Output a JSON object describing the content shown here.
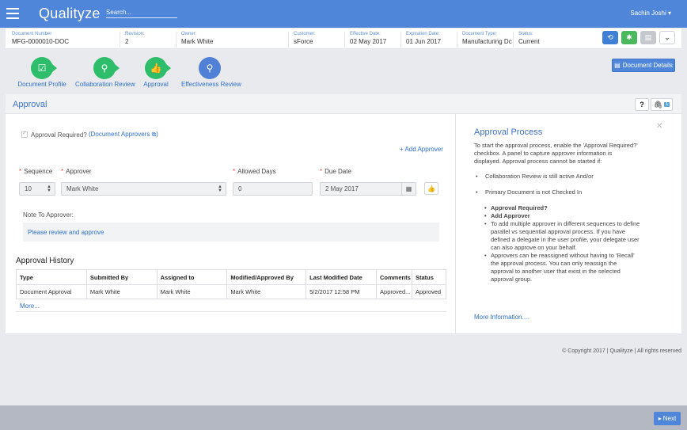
{
  "app": {
    "logo": "Qualityze",
    "search_placeholder": "Search...",
    "user": "Sachin Joshi ▾"
  },
  "info": [
    {
      "label": "Document Number",
      "value": "MFG-0000010-DOC"
    },
    {
      "label": "Revision:",
      "value": "2"
    },
    {
      "label": "Owner:",
      "value": "Mark White"
    },
    {
      "label": "Customer:",
      "value": "sForce"
    },
    {
      "label": "Effective Date:",
      "value": "02 May 2017"
    },
    {
      "label": "Expiration Date:",
      "value": "01 Jun 2017"
    },
    {
      "label": "Document Type:",
      "value": "Manufacturing Dc"
    },
    {
      "label": "Status:",
      "value": "Current"
    }
  ],
  "toolbar_colors": {
    "refresh": "#3f7fd6",
    "settings": "#4cb85c",
    "print": "#c5c8cd",
    "more": "#ffffff"
  },
  "steps": [
    {
      "label": "Document Profile"
    },
    {
      "label": "Collaboration Review"
    },
    {
      "label": "Approval"
    },
    {
      "label": "Effectiveness Review"
    }
  ],
  "doc_details": "Document Details",
  "panel": {
    "title": "Approval",
    "help": "?",
    "attach_count": "1",
    "approval_required": "Approval Required?",
    "document_approvers": "(Document Approvers",
    "add_approver": "+ Add Approver",
    "cols": {
      "sequence": "Sequence",
      "approver": "Approver",
      "allowed_days": "Allowed Days",
      "due_date": "Due Date"
    },
    "values": {
      "sequence": "10",
      "approver": "Mark White",
      "allowed_days": "0",
      "due_date": "2 May 2017"
    },
    "note_label": "Note To Approver:",
    "note_value": "Please review and approve"
  },
  "history": {
    "title": "Approval History",
    "headers": [
      "Type",
      "Submitted By",
      "Assigned to",
      "Modified/Approved By",
      "Last Modified Date",
      "Comments",
      "Status"
    ],
    "rows": [
      [
        "Document Approval",
        "Mark White",
        "Mark White",
        "Mark White",
        "5/2/2017 12:58 PM",
        "Approved...",
        "Approved"
      ]
    ],
    "more": "More..."
  },
  "process": {
    "title": "Approval Process",
    "intro": "To start the approval process, enable the 'Approval Required?' checkbox. A panel to capture approver information is displayed. Approval process cannot be started if:",
    "bullet1": "Collaboration Review is still active And/or",
    "bullet2": "Primary Document is not Checked In",
    "sub1": "Approval Required?",
    "sub2": "Add Approver",
    "sub3": "To add multiple approver in different sequences to define parallel vs sequential approval process. If you have defined a delegate in the user profile, your delegate user can also approve on your behalf.",
    "sub4": "Approvers can be reassigned without having to 'Recall' the approval process. You can only reassign the approval to another user that exist in the selected approval group.",
    "more": "More Information...."
  },
  "copyright": "© Copyright 2017 | Qualityze | All rights reserved",
  "next": "Next"
}
